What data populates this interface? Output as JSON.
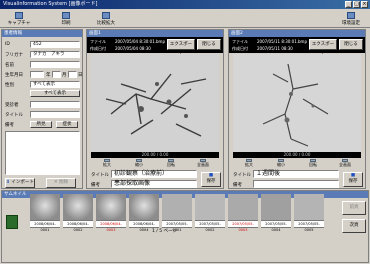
{
  "window": {
    "title": "Visualinformation System [画像ボード]",
    "buttons": [
      "_",
      "□",
      "×"
    ]
  },
  "toolbar": {
    "capture_label": "キャプチャ",
    "print_label": "印刷",
    "compare_label": "比較拡大",
    "settings_label": "環境設定"
  },
  "patient": {
    "header": "患者情報",
    "id_label": "ID",
    "id_value": "452",
    "furigana_label": "フリガナ",
    "furigana_value": "タナカ　アキラ",
    "name_label": "名前",
    "dob_label": "生年月日",
    "year_suffix": "年",
    "month_suffix": "月",
    "day_suffix": "日",
    "gender_label": "性別",
    "gender_value": "すべて表示",
    "show_all_button": "すべて表示",
    "record_label": "受診者",
    "title_label": "タイトル",
    "remarks_label": "備考",
    "date_btn": "所見",
    "doc_btn": "症状",
    "import_button": "インポート",
    "delete_button": "削除"
  },
  "viewer1": {
    "header": "画面1",
    "file_label": "ファイル",
    "file_value": "2007/05/04 8:30:01.bmp",
    "date_label": "作成日付",
    "date_value": "2007/05/04 08:30",
    "export_button": "エクスポート",
    "close_button": "閉じる",
    "status": "200.00 / 0.00",
    "controls": [
      "拡大",
      "縮小",
      "回転",
      "全画面"
    ],
    "title_label": "タイトル",
    "title_value": "初診観察（治療前）",
    "remarks_label": "備考",
    "remarks_value": "患部採取画像",
    "save_button": "保存"
  },
  "viewer2": {
    "header": "画面2",
    "file_label": "ファイル",
    "file_value": "2007/05/11 8:30:01.bmp",
    "date_label": "作成日付",
    "date_value": "2007/05/11 08:30",
    "export_button": "エクスポート",
    "close_button": "閉じる",
    "status": "200.00 / 0.00",
    "controls": [
      "拡大",
      "縮小",
      "回転",
      "全画面"
    ],
    "title_label": "タイトル",
    "title_value": "１週間後",
    "remarks_label": "備考",
    "remarks_value": "",
    "save_button": "保存"
  },
  "thumbnails": {
    "header": "サムネイル",
    "items": [
      {
        "label": "2008/06/04-0001",
        "red": false
      },
      {
        "label": "2008/06/04-0002",
        "red": false
      },
      {
        "label": "2008/06/04-0003",
        "red": true
      },
      {
        "label": "2008/06/04-0004",
        "red": false
      },
      {
        "label": "2007/05/05-0001",
        "red": false
      },
      {
        "label": "2007/05/05-0002",
        "red": false
      },
      {
        "label": "2007/05/05-0003",
        "red": true
      },
      {
        "label": "2007/05/05-0004",
        "red": false
      },
      {
        "label": "2007/05/05-0005",
        "red": false
      }
    ],
    "page_indicator": "1 / 5 ページ",
    "next_button": "次頁",
    "prev_button": "前頁"
  }
}
